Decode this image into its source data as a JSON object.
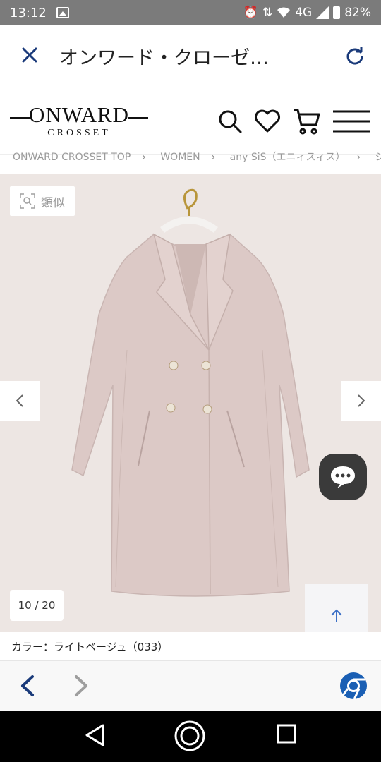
{
  "status_bar": {
    "time": "13:12",
    "network": "4G",
    "battery": "82%",
    "icons": [
      "gallery-icon",
      "alarm-icon",
      "data-arrows-icon",
      "wifi-icon",
      "signal-icon",
      "battery-icon"
    ]
  },
  "tab_header": {
    "close_icon": "close-icon",
    "title": "オンワード・クローゼ…",
    "reload_icon": "reload-icon"
  },
  "site_header": {
    "logo_main": "ONWARD",
    "logo_sub": "CROSSET",
    "icons": [
      "search-icon",
      "heart-icon",
      "cart-icon",
      "menu-icon"
    ]
  },
  "breadcrumb": [
    "ONWARD CROSSET TOP",
    "WOMEN",
    "any SiS（エニィスィス）",
    "ジャ"
  ],
  "product": {
    "similar_label": "類似",
    "image_counter": "10 / 20",
    "prev_icon": "chevron-left-icon",
    "next_icon": "chevron-right-icon",
    "chat_icon": "chat-icon",
    "to_top_icon": "arrow-up-icon",
    "color_label": "カラー：ライトベージュ（033）"
  },
  "colors": {
    "accent_navy": "#1a3a7a",
    "product_bg": "#ede6e3",
    "coat": "#dcc9c6"
  }
}
